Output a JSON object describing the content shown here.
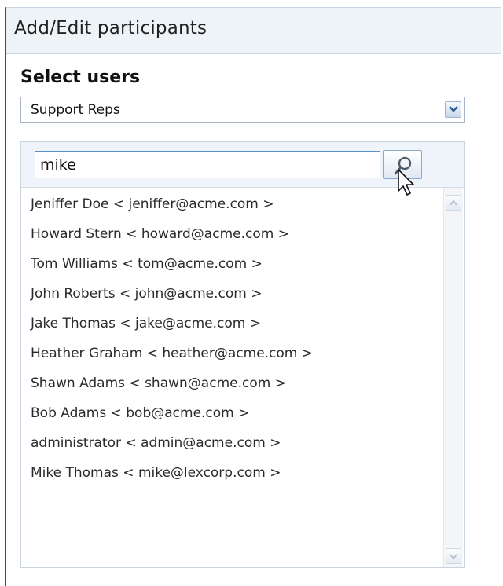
{
  "header": {
    "title": "Add/Edit participants"
  },
  "select_users": {
    "title": "Select users",
    "group_value": "Support Reps"
  },
  "search": {
    "value": "mike"
  },
  "users": [
    "Jeniffer Doe < jeniffer@acme.com >",
    "Howard Stern < howard@acme.com >",
    "Tom Williams < tom@acme.com >",
    "John Roberts < john@acme.com >",
    "Jake Thomas < jake@acme.com >",
    "Heather Graham < heather@acme.com >",
    "Shawn Adams < shawn@acme.com >",
    "Bob Adams < bob@acme.com >",
    "administrator < admin@acme.com >",
    "Mike Thomas < mike@lexcorp.com >"
  ],
  "icons": {
    "dropdown": "chevron-down-icon",
    "search": "search-icon",
    "cursor": "mouse-pointer-icon",
    "scroll_up": "chevron-up-icon",
    "scroll_down": "chevron-down-icon"
  },
  "colors": {
    "header_bg": "#eef3f8",
    "accent_border": "#5c8ec6",
    "text": "#2a2a2a"
  }
}
